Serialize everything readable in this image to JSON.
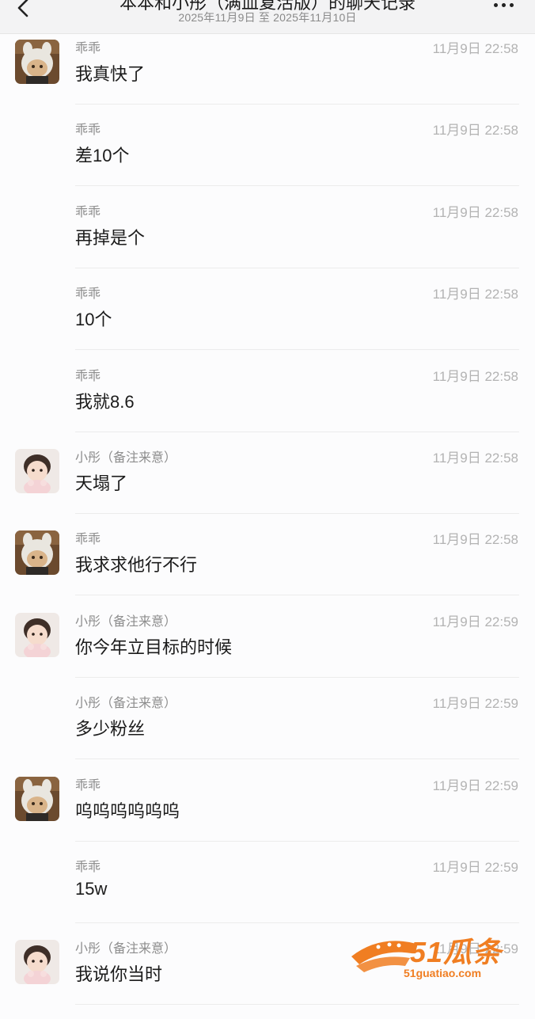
{
  "header": {
    "title": "本本和小彤（满血复活版）的聊天记录",
    "subtitle": "2025年11月9日 至 2025年11月10日"
  },
  "messages": [
    {
      "sender": "乖乖",
      "time": "11月9日 22:58",
      "text": "我真快了",
      "avatar": "boy"
    },
    {
      "sender": "乖乖",
      "time": "11月9日 22:58",
      "text": "差10个",
      "avatar": ""
    },
    {
      "sender": "乖乖",
      "time": "11月9日 22:58",
      "text": "再掉是个",
      "avatar": ""
    },
    {
      "sender": "乖乖",
      "time": "11月9日 22:58",
      "text": "10个",
      "avatar": ""
    },
    {
      "sender": "乖乖",
      "time": "11月9日 22:58",
      "text": "我就8.6",
      "avatar": ""
    },
    {
      "sender": "小彤（备注来意）",
      "time": "11月9日 22:58",
      "text": "天塌了",
      "avatar": "girl"
    },
    {
      "sender": "乖乖",
      "time": "11月9日 22:58",
      "text": "我求求他行不行",
      "avatar": "boy"
    },
    {
      "sender": "小彤（备注来意）",
      "time": "11月9日 22:59",
      "text": "你今年立目标的时候",
      "avatar": "girl"
    },
    {
      "sender": "小彤（备注来意）",
      "time": "11月9日 22:59",
      "text": "多少粉丝",
      "avatar": ""
    },
    {
      "sender": "乖乖",
      "time": "11月9日 22:59",
      "text": "呜呜呜呜呜呜",
      "avatar": "boy"
    },
    {
      "sender": "乖乖",
      "time": "11月9日 22:59",
      "text": "15w",
      "avatar": ""
    },
    {
      "sender": "小彤（备注来意）",
      "time": "11月9日 22:59",
      "text": "我说你当时",
      "avatar": "girl"
    }
  ],
  "watermark": {
    "brand": "51瓜条",
    "url": "51guatiao.com"
  },
  "colors": {
    "watermark": "#f07e22",
    "header_bg": "#f3f3f4",
    "page_bg": "#fcfcfd"
  }
}
